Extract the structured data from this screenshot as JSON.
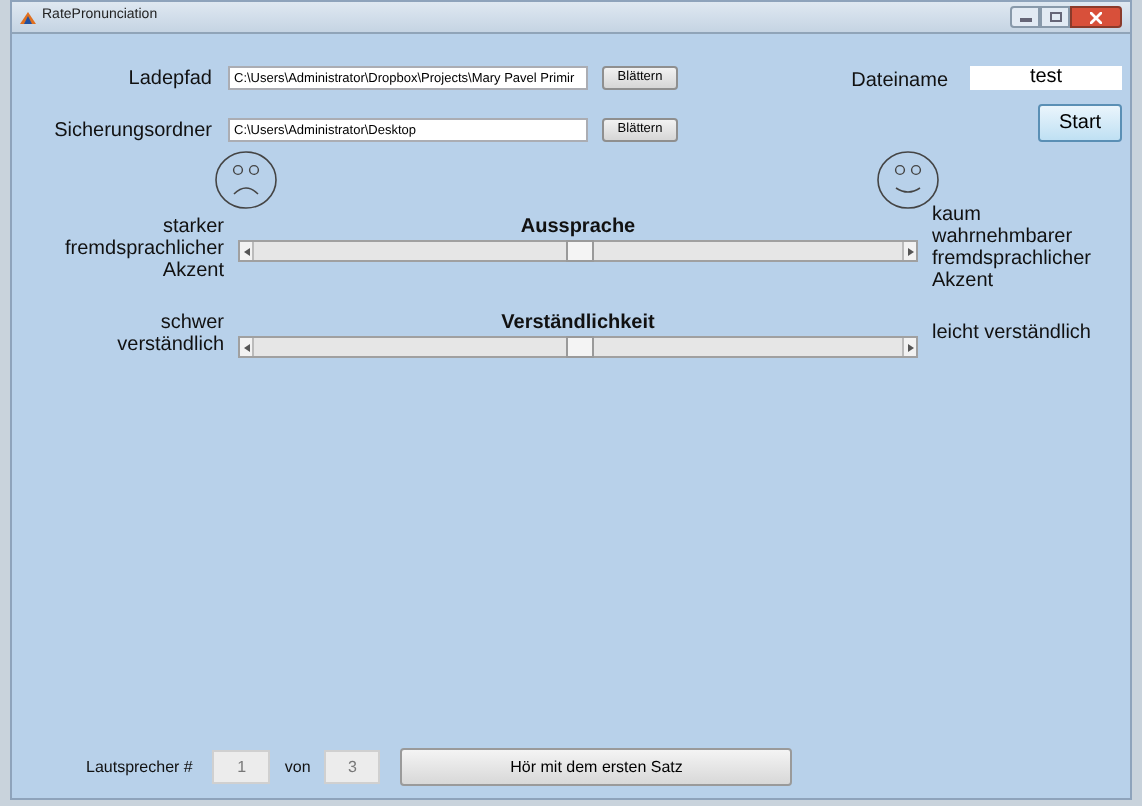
{
  "window": {
    "title": "RatePronunciation"
  },
  "load_path": {
    "label": "Ladepfad",
    "value": "C:\\Users\\Administrator\\Dropbox\\Projects\\Mary Pavel Primir",
    "button": "Blättern"
  },
  "save_folder": {
    "label": "Sicherungsordner",
    "value": "C:\\Users\\Administrator\\Desktop",
    "button": "Blättern"
  },
  "file_name": {
    "label": "Dateiname",
    "value": "test"
  },
  "start_button": "Start",
  "sliders": [
    {
      "title": "Aussprache",
      "left_label": "starker fremdsprachlicher Akzent",
      "right_label": "kaum wahrnehmbarer fremdsprachlicher Akzent",
      "level": 0.5
    },
    {
      "title": "Verständlichkeit",
      "left_label": "schwer verständlich",
      "right_label": "leicht verständlich",
      "level": 0.5
    }
  ],
  "speaker": {
    "label": "Lautsprecher #",
    "current": "1",
    "of_label": "von",
    "total": "3"
  },
  "play_button": "Hör mit dem ersten Satz"
}
